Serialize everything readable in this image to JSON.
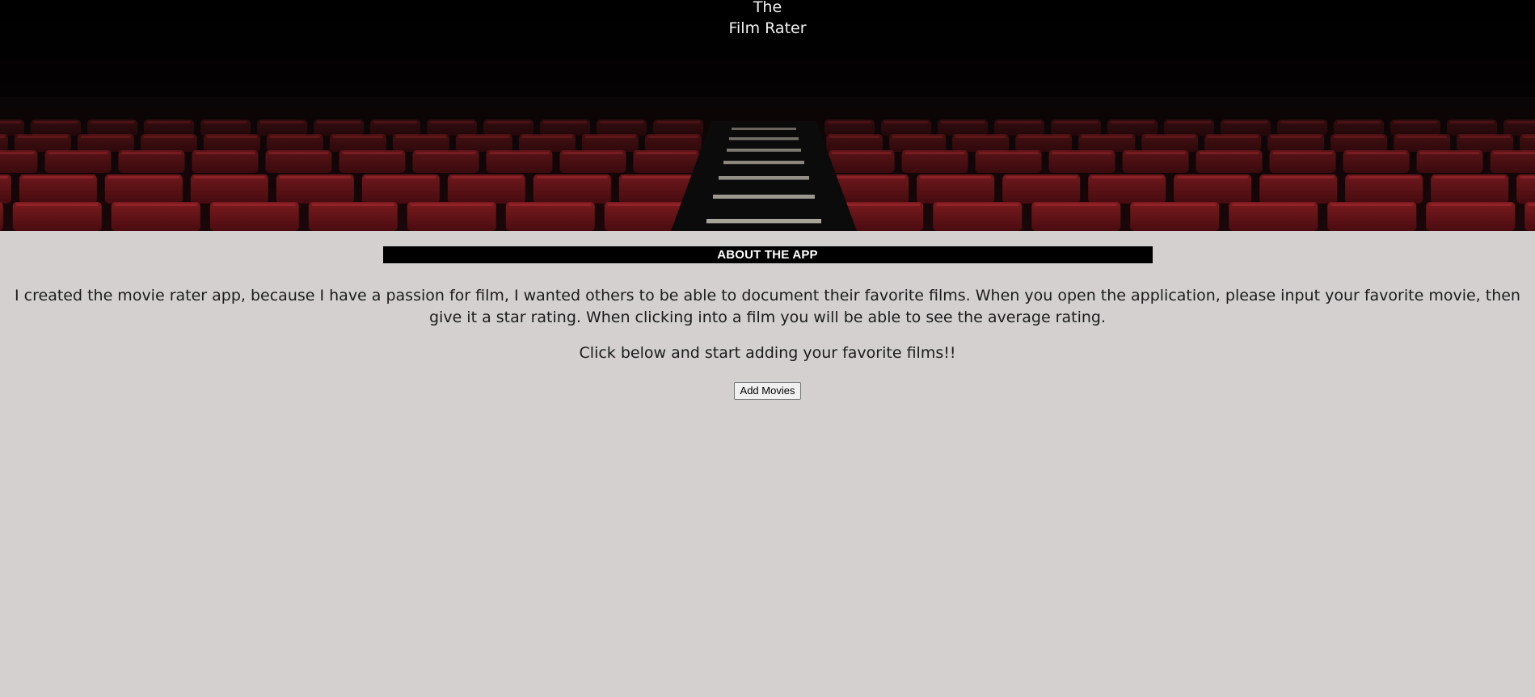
{
  "header": {
    "title_line1": "The",
    "title_line2": "Film Rater",
    "hero_image": "movie-theater-red-seats-image"
  },
  "about": {
    "heading": "ABOUT THE APP",
    "description": "I created the movie rater app, because I have a passion for film, I wanted others to be able to document their favorite films. When you open the application, please input your favorite movie, then give it a star rating. When clicking into a film you will be able to see the average rating.",
    "cta": "Click below and start adding your favorite films!!",
    "add_button_label": "Add Movies"
  },
  "colors": {
    "page_background": "#d3d0cf",
    "heading_bar": "#000000",
    "seat_red": "#6e1418"
  }
}
